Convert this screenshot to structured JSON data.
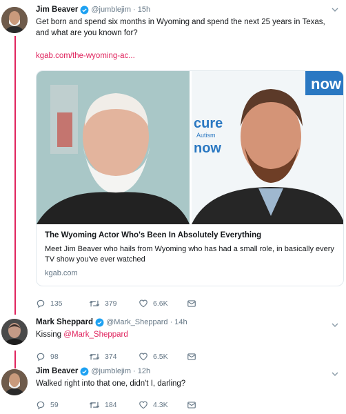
{
  "tweets": [
    {
      "name": "Jim Beaver",
      "handle": "@jumblejim",
      "time": "15h",
      "text": "Get born and spend six months in Wyoming and spend the next 25 years in Texas, and what are you known for?",
      "link": "kgab.com/the-wyoming-ac...",
      "card": {
        "title": "The Wyoming Actor Who's Been In Absolutely Everything",
        "description": "Meet Jim Beaver who hails from Wyoming who has had a small role, in basically every TV show you've ever watched",
        "domain": "kgab.com",
        "backdrop_text": {
          "cure": "cure",
          "autism": "Autism",
          "now": "now"
        }
      },
      "replies": "135",
      "retweets": "379",
      "likes": "6.6K"
    },
    {
      "name": "Mark Sheppard",
      "handle": "@Mark_Sheppard",
      "time": "14h",
      "text_prefix": "Kissing ",
      "mention": "@Mark_Sheppard",
      "replies": "98",
      "retweets": "374",
      "likes": "6.5K"
    },
    {
      "name": "Jim Beaver",
      "handle": "@jumblejim",
      "time": "12h",
      "text": "Walked right into that one, didn't I, darling?",
      "replies": "59",
      "retweets": "184",
      "likes": "4.3K"
    }
  ],
  "colors": {
    "accent": "#e0245e",
    "verified": "#1da1f2",
    "muted": "#657786"
  },
  "icons": [
    "verified-badge-icon",
    "chevron-down-icon",
    "reply-icon",
    "retweet-icon",
    "like-icon",
    "share-icon"
  ]
}
